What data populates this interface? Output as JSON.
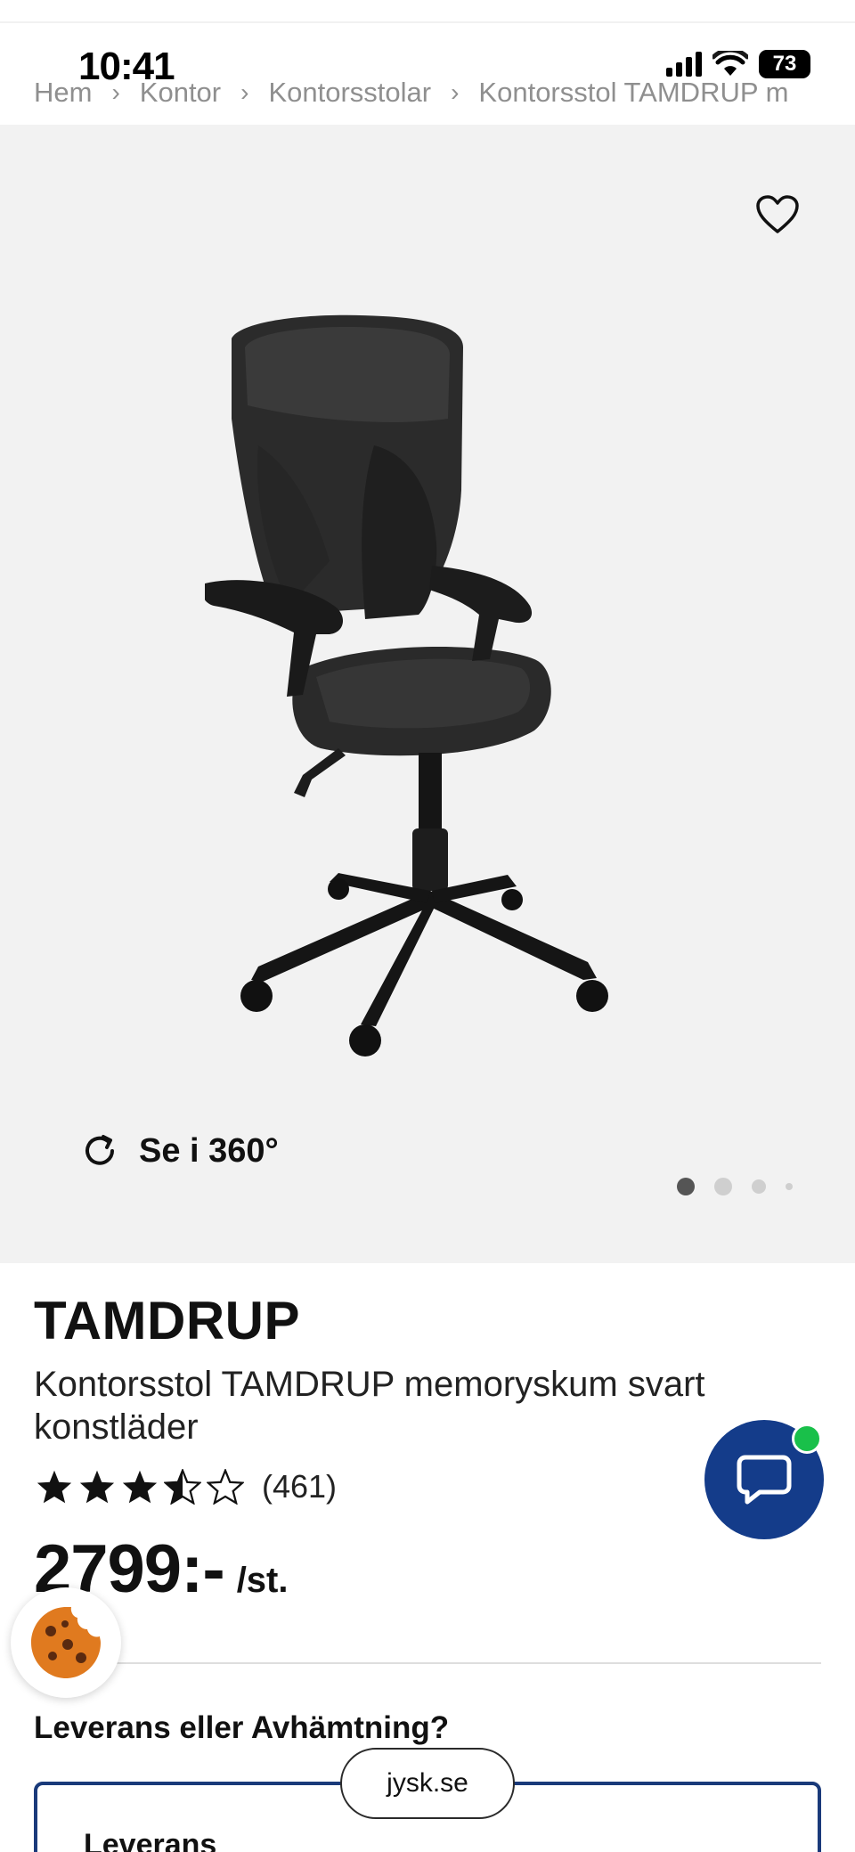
{
  "status_bar": {
    "time": "10:41",
    "battery": "73"
  },
  "breadcrumb": {
    "items": [
      "Hem",
      "Kontor",
      "Kontorsstolar",
      "Kontorsstol TAMDRUP m"
    ],
    "separator": "›"
  },
  "gallery": {
    "rotate_label": "Se i 360°",
    "dots_count": 4,
    "active_dot": 0
  },
  "product": {
    "brand": "TAMDRUP",
    "name": "Kontorsstol TAMDRUP memoryskum svart konstläder",
    "rating": 3.5,
    "rating_max": 5,
    "review_count": "(461)",
    "price": "2799:-",
    "price_unit": "/st."
  },
  "delivery": {
    "question": "Leverans eller Avhämtning?",
    "option_label": "Leverans"
  },
  "browser": {
    "url": "jysk.se"
  },
  "colors": {
    "accent_navy": "#143c8a",
    "online_green": "#19c04a",
    "media_bg": "#f2f2f2"
  },
  "icons": {
    "wishlist": "heart-outline-icon",
    "rotate": "rotate-360-icon",
    "chat": "chat-bubble-icon",
    "cookie": "cookie-icon"
  }
}
